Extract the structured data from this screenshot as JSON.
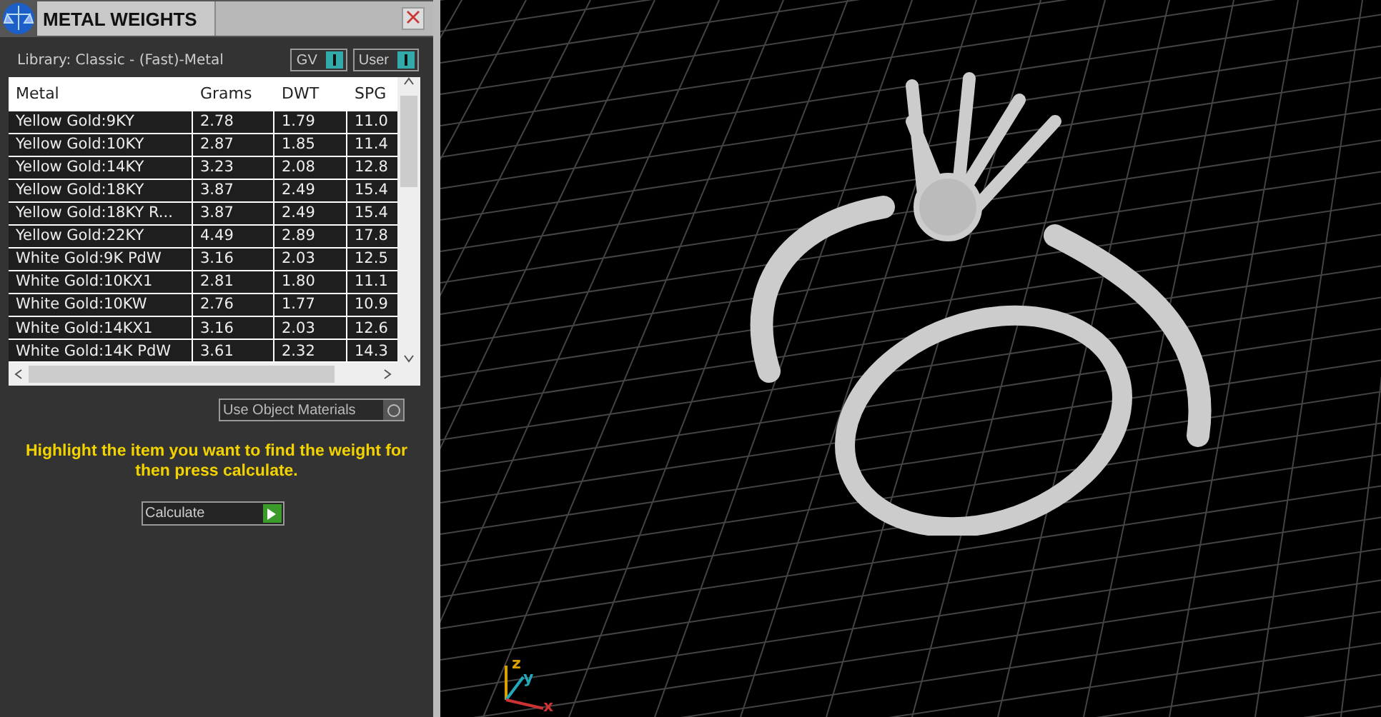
{
  "panel": {
    "title": "METAL WEIGHTS",
    "library": "Library: Classic - (Fast)-Metal",
    "toggles": [
      {
        "label": "GV",
        "on": true
      },
      {
        "label": "User",
        "on": true
      }
    ]
  },
  "table": {
    "columns": [
      "Metal",
      "Grams",
      "DWT",
      "SPG"
    ],
    "rows": [
      [
        "Yellow Gold:9KY",
        "2.78",
        "1.79",
        "11.0"
      ],
      [
        "Yellow Gold:10KY",
        "2.87",
        "1.85",
        "11.4"
      ],
      [
        "Yellow Gold:14KY",
        "3.23",
        "2.08",
        "12.8"
      ],
      [
        "Yellow Gold:18KY",
        "3.87",
        "2.49",
        "15.4"
      ],
      [
        "Yellow Gold:18KY R...",
        "3.87",
        "2.49",
        "15.4"
      ],
      [
        "Yellow Gold:22KY",
        "4.49",
        "2.89",
        "17.8"
      ],
      [
        "White Gold:9K PdW",
        "3.16",
        "2.03",
        "12.5"
      ],
      [
        "White Gold:10KX1",
        "2.81",
        "1.80",
        "11.1"
      ],
      [
        "White Gold:10KW",
        "2.76",
        "1.77",
        "10.9"
      ],
      [
        "White Gold:14KX1",
        "3.16",
        "2.03",
        "12.6"
      ],
      [
        "White Gold:14K PdW",
        "3.61",
        "2.32",
        "14.3"
      ]
    ]
  },
  "use_object_materials": {
    "label": "Use Object Materials",
    "on": false
  },
  "instructions": "Highlight the item you want to find the weight for then press calculate.",
  "calculate_button": "Calculate",
  "axes": {
    "x": "x",
    "y": "y",
    "z": "z"
  }
}
